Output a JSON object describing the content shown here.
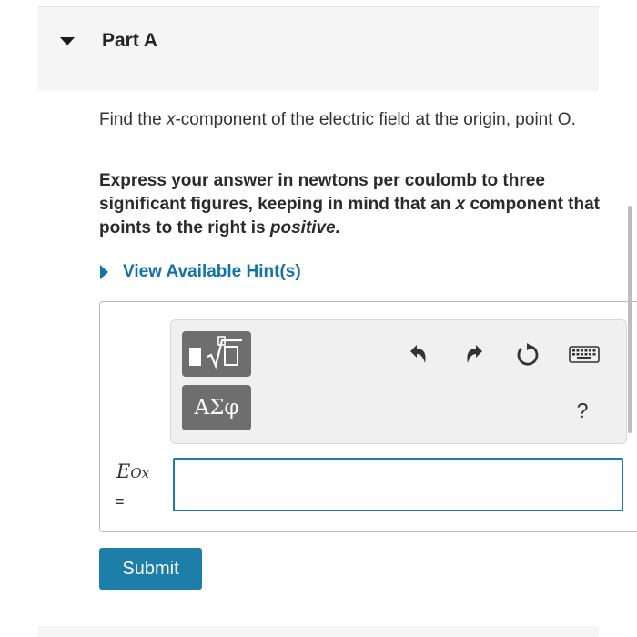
{
  "part": {
    "title": "Part A"
  },
  "question": {
    "prefix": "Find the ",
    "var": "x",
    "suffix": "-component of the electric field at the origin, point O."
  },
  "instruction": {
    "before_x": "Express your answer in newtons per coulomb to three significant figures, keeping in mind that an ",
    "x": "x",
    "middle": " component that points to the right is ",
    "emphasis": "positive."
  },
  "hint": {
    "label": "View Available Hint(s)"
  },
  "toolbar": {
    "symbols_label": "ΑΣφ",
    "help_label": "?",
    "icons": [
      "templates-icon",
      "undo-icon",
      "redo-icon",
      "reset-icon",
      "keyboard-icon",
      "help-icon"
    ]
  },
  "answer": {
    "var_main": "E",
    "var_sub": "Ox",
    "equals": "=",
    "value": "",
    "placeholder": ""
  },
  "submit": {
    "label": "Submit"
  },
  "colors": {
    "accent": "#1c7ea9",
    "link": "#1273a4",
    "toolbar_button": "#6e6e6e",
    "header_bg": "#f5f5f5"
  }
}
